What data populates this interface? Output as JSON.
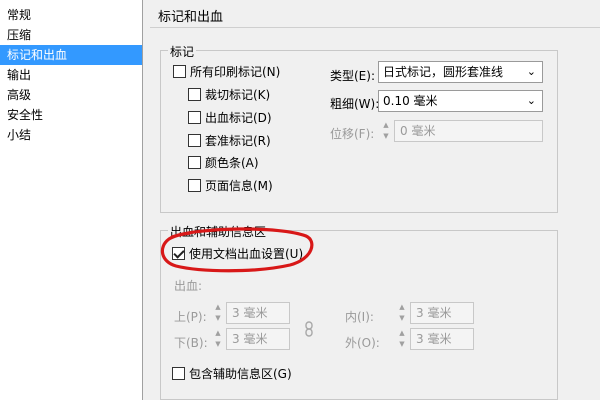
{
  "sidebar": {
    "items": [
      {
        "label": "常规"
      },
      {
        "label": "压缩"
      },
      {
        "label": "标记和出血"
      },
      {
        "label": "输出"
      },
      {
        "label": "高级"
      },
      {
        "label": "安全性"
      },
      {
        "label": "小结"
      }
    ],
    "selected_index": 2,
    "selected_color": "#3399ff"
  },
  "panel": {
    "title": "标记和出血"
  },
  "marks": {
    "group_title": "标记",
    "all_marks": {
      "label": "所有印刷标记(N)",
      "checked": false
    },
    "items": [
      {
        "label": "裁切标记(K)",
        "checked": false
      },
      {
        "label": "出血标记(D)",
        "checked": false
      },
      {
        "label": "套准标记(R)",
        "checked": false
      },
      {
        "label": "颜色条(A)",
        "checked": false
      },
      {
        "label": "页面信息(M)",
        "checked": false
      }
    ],
    "type": {
      "label": "类型(E):",
      "value": "日式标记，圆形套准线"
    },
    "weight": {
      "label": "粗细(W):",
      "value": "0.10 毫米"
    },
    "offset": {
      "label": "位移(F):",
      "value": "0 毫米"
    }
  },
  "bleed": {
    "group_title": "出血和辅助信息区",
    "use_doc_bleed": {
      "label": "使用文档出血设置(U)",
      "checked": true
    },
    "bleed_label": "出血:",
    "top": {
      "label": "上(P):",
      "value": "3 毫米"
    },
    "bottom": {
      "label": "下(B):",
      "value": "3 毫米"
    },
    "inside": {
      "label": "内(I):",
      "value": "3 毫米"
    },
    "outside": {
      "label": "外(O):",
      "value": "3 毫米"
    },
    "include_slug": {
      "label": "包含辅助信息区(G)",
      "checked": false
    }
  },
  "annotation_color": "#d81818"
}
